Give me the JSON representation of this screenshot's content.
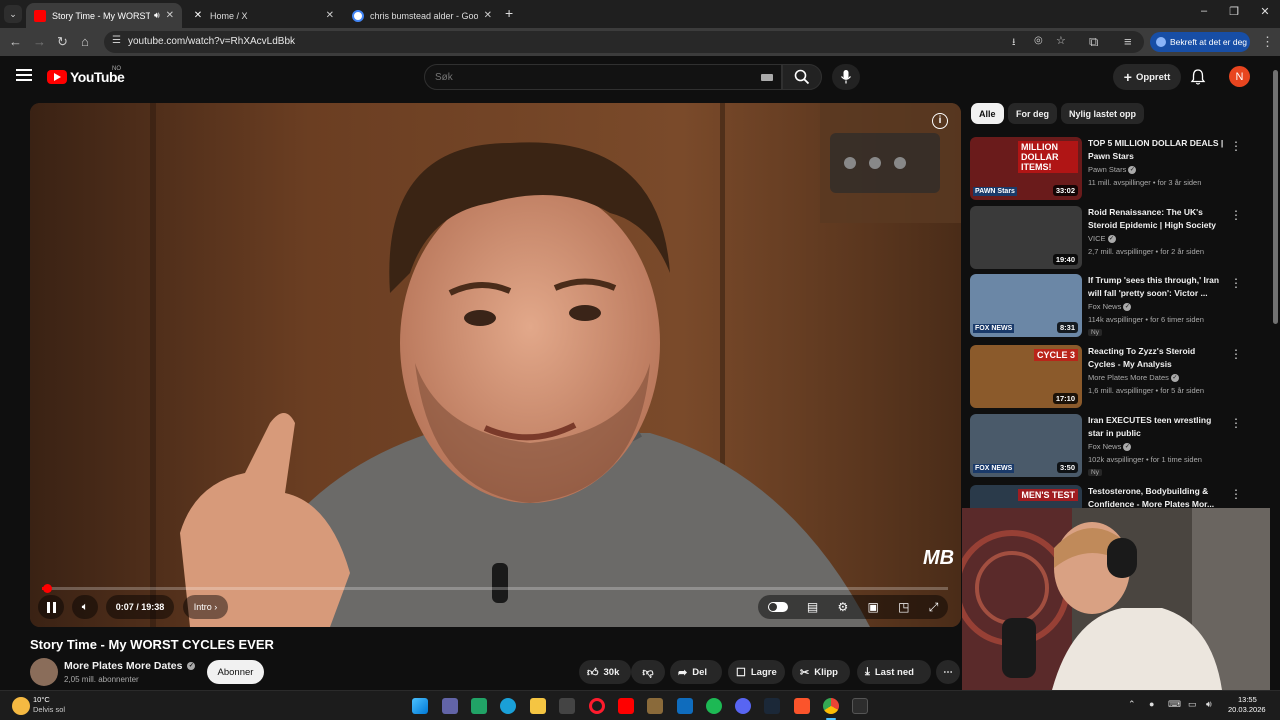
{
  "browser": {
    "tabs": [
      {
        "title": "Story Time - My WORST CYCLES EVER",
        "active": true,
        "favicon_color": "#ff0000",
        "audio": true
      },
      {
        "title": "Home / X",
        "active": false,
        "favicon_color": "#ffffff"
      },
      {
        "title": "chris bumstead alder - Google",
        "active": false,
        "favicon_color": "#4285f4"
      }
    ],
    "new_tab_icon": "plus-icon",
    "url": "youtube.com/watch?v=RhXAcvLdBbk",
    "profile_label": "Bekreft at det er deg"
  },
  "youtube": {
    "logo_text": "YouTube",
    "country_code": "NO",
    "search_placeholder": "Søk",
    "create_label": "Opprett",
    "avatar_letter": "N",
    "brand_color": "#ff0000"
  },
  "player": {
    "time_current": "0:07",
    "time_separator": "/",
    "time_total": "19:38",
    "chapter": "Intro",
    "progress_fraction": 0.006,
    "watermark": "MB"
  },
  "video": {
    "title": "Story Time - My WORST CYCLES EVER",
    "channel": "More Plates More Dates",
    "subscribers": "2,05 mill. abonnenter",
    "subscribe_label": "Abonner",
    "likes": "30k",
    "share_label": "Del",
    "save_label": "Lagre",
    "clip_label": "Klipp",
    "download_label": "Last ned"
  },
  "filters": [
    "Alle",
    "For deg",
    "Nylig lastet opp"
  ],
  "recommendations": [
    {
      "title": "TOP 5 MILLION DOLLAR DEALS | Pawn Stars",
      "channel": "Pawn Stars",
      "meta": "11 mill. avspillinger • for 3 år siden",
      "duration": "33:02",
      "badge": "",
      "thumb_color": "#6a1b1b",
      "thumb_text": "MILLION DOLLAR ITEMS!",
      "thumb_sub": "PAWN Stars"
    },
    {
      "title": "Roid Renaissance: The UK's Steroid Epidemic | High Society",
      "channel": "VICE",
      "meta": "2,7 mill. avspillinger • for 2 år siden",
      "duration": "19:40",
      "badge": "",
      "thumb_color": "#3a3a3a",
      "thumb_text": "",
      "thumb_sub": ""
    },
    {
      "title": "If Trump 'sees this through,' Iran will fall 'pretty soon': Victor ...",
      "channel": "Fox News",
      "meta": "114k avspillinger • for 6 timer siden",
      "duration": "8:31",
      "badge": "Ny",
      "thumb_color": "#6b87a6",
      "thumb_text": "",
      "thumb_sub": "FOX NEWS"
    },
    {
      "title": "Reacting To Zyzz's Steroid Cycles - My Analysis",
      "channel": "More Plates More Dates",
      "meta": "1,6 mill. avspillinger • for 5 år siden",
      "duration": "17:10",
      "badge": "",
      "thumb_color": "#8b5a2b",
      "thumb_text": "CYCLE 3",
      "thumb_sub": ""
    },
    {
      "title": "Iran EXECUTES teen wrestling star in public",
      "channel": "Fox News",
      "meta": "102k avspillinger • for 1 time siden",
      "duration": "3:50",
      "badge": "Ny",
      "thumb_color": "#4a5a6a",
      "thumb_text": "",
      "thumb_sub": "FOX NEWS"
    },
    {
      "title": "Testosterone, Bodybuilding & Confidence - More Plates Mor...",
      "channel": "",
      "meta": "",
      "duration": "",
      "badge": "",
      "thumb_color": "#2a3a4a",
      "thumb_text": "MEN'S TEST",
      "thumb_sub": ""
    }
  ],
  "taskbar": {
    "temperature": "10°C",
    "weather": "Delvis sol",
    "time": "13:55",
    "date": "20.03.2026"
  }
}
